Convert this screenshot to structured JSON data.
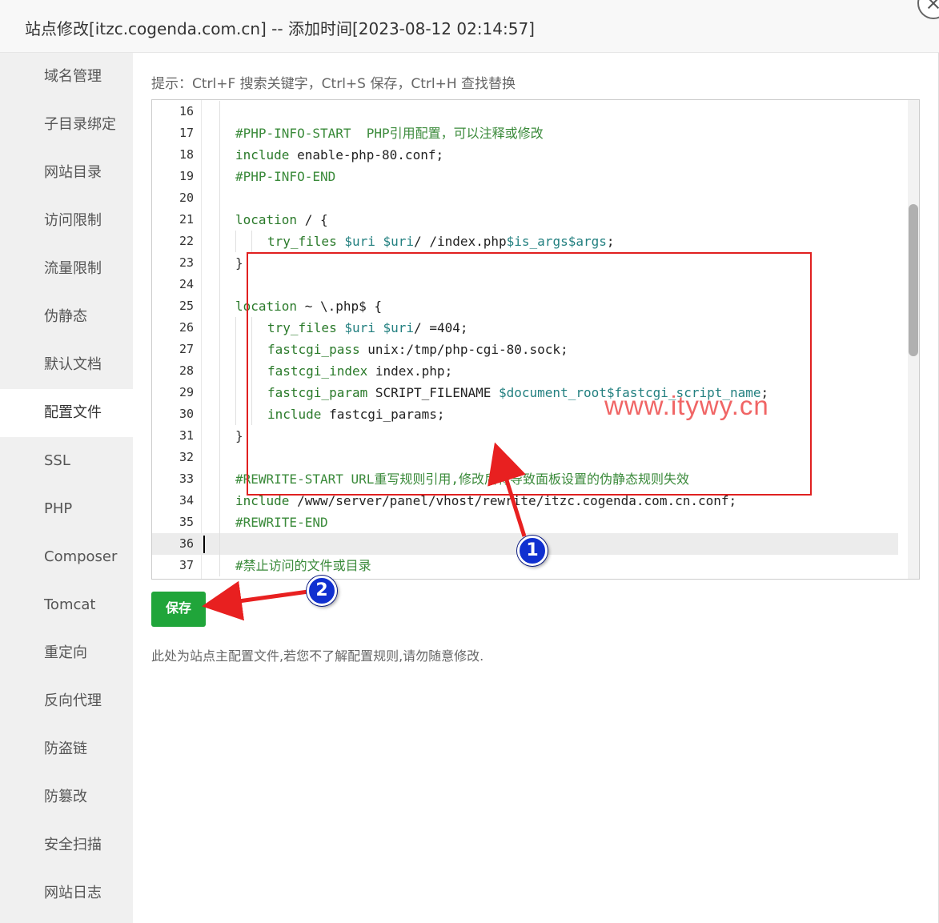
{
  "window": {
    "title": "站点修改[itzc.cogenda.com.cn] -- 添加时间[2023-08-12 02:14:57]"
  },
  "sidebar": {
    "items": [
      {
        "label": "域名管理"
      },
      {
        "label": "子目录绑定"
      },
      {
        "label": "网站目录"
      },
      {
        "label": "访问限制"
      },
      {
        "label": "流量限制"
      },
      {
        "label": "伪静态"
      },
      {
        "label": "默认文档"
      },
      {
        "label": "配置文件",
        "active": true
      },
      {
        "label": "SSL"
      },
      {
        "label": "PHP"
      },
      {
        "label": "Composer"
      },
      {
        "label": "Tomcat"
      },
      {
        "label": "重定向"
      },
      {
        "label": "反向代理"
      },
      {
        "label": "防盗链"
      },
      {
        "label": "防篡改"
      },
      {
        "label": "安全扫描"
      },
      {
        "label": "网站日志"
      }
    ]
  },
  "main": {
    "hint": "提示：Ctrl+F 搜索关键字，Ctrl+S 保存，Ctrl+H 查找替换",
    "save_label": "保存",
    "note": "此处为站点主配置文件,若您不了解配置规则,请勿随意修改."
  },
  "editor": {
    "current_line": "36",
    "lines": [
      {
        "n": "16",
        "parts": []
      },
      {
        "n": "17",
        "parts": [
          [
            "c-comment",
            "#PHP-INFO-START  PHP引用配置，可以注释或修改"
          ]
        ]
      },
      {
        "n": "18",
        "parts": [
          [
            "c-kw",
            "include"
          ],
          [
            "c-plain",
            " enable-php-80.conf;"
          ]
        ]
      },
      {
        "n": "19",
        "parts": [
          [
            "c-comment",
            "#PHP-INFO-END"
          ]
        ]
      },
      {
        "n": "20",
        "parts": []
      },
      {
        "n": "21",
        "parts": [
          [
            "c-kw",
            "location"
          ],
          [
            "c-plain",
            " / {"
          ]
        ]
      },
      {
        "n": "22",
        "deep": true,
        "parts": [
          [
            "c-fn",
            "try_files"
          ],
          [
            "c-plain",
            " "
          ],
          [
            "c-var",
            "$uri"
          ],
          [
            "c-plain",
            " "
          ],
          [
            "c-var",
            "$uri"
          ],
          [
            "c-plain",
            "/ /index.php"
          ],
          [
            "c-var",
            "$is_args$args"
          ],
          [
            "c-plain",
            ";"
          ]
        ]
      },
      {
        "n": "23",
        "parts": [
          [
            "c-brace",
            "}"
          ]
        ]
      },
      {
        "n": "24",
        "parts": []
      },
      {
        "n": "25",
        "parts": [
          [
            "c-kw",
            "location"
          ],
          [
            "c-plain",
            " ~ \\.php$ {"
          ]
        ]
      },
      {
        "n": "26",
        "deep": true,
        "parts": [
          [
            "c-fn",
            "try_files"
          ],
          [
            "c-plain",
            " "
          ],
          [
            "c-var",
            "$uri"
          ],
          [
            "c-plain",
            " "
          ],
          [
            "c-var",
            "$uri"
          ],
          [
            "c-plain",
            "/ =404;"
          ]
        ]
      },
      {
        "n": "27",
        "deep": true,
        "parts": [
          [
            "c-fn",
            "fastcgi_pass"
          ],
          [
            "c-plain",
            " unix:/tmp/php-cgi-80.sock;"
          ]
        ]
      },
      {
        "n": "28",
        "deep": true,
        "parts": [
          [
            "c-fn",
            "fastcgi_index"
          ],
          [
            "c-plain",
            " index.php;"
          ]
        ]
      },
      {
        "n": "29",
        "deep": true,
        "parts": [
          [
            "c-fn",
            "fastcgi_param"
          ],
          [
            "c-plain",
            " SCRIPT_FILENAME "
          ],
          [
            "c-var",
            "$document_root$fastcgi_script_name"
          ],
          [
            "c-plain",
            ";"
          ]
        ]
      },
      {
        "n": "30",
        "deep": true,
        "parts": [
          [
            "c-kw",
            "include"
          ],
          [
            "c-plain",
            " fastcgi_params;"
          ]
        ]
      },
      {
        "n": "31",
        "parts": [
          [
            "c-brace",
            "}"
          ]
        ]
      },
      {
        "n": "32",
        "parts": []
      },
      {
        "n": "33",
        "parts": [
          [
            "c-comment",
            "#REWRITE-START URL重写规则引用,修改后将导致面板设置的伪静态规则失效"
          ]
        ]
      },
      {
        "n": "34",
        "parts": [
          [
            "c-kw",
            "include"
          ],
          [
            "c-plain",
            " /www/server/panel/vhost/rewrite/itzc.cogenda.com.cn.conf;"
          ]
        ]
      },
      {
        "n": "35",
        "parts": [
          [
            "c-comment",
            "#REWRITE-END"
          ]
        ]
      },
      {
        "n": "36",
        "parts": []
      },
      {
        "n": "37",
        "parts": [
          [
            "c-comment",
            "#禁止访问的文件或目录"
          ]
        ]
      }
    ]
  },
  "annotations": {
    "badge1": "1",
    "badge2": "2",
    "watermark": "www.itywy.cn",
    "arrow_color": "#e82020",
    "badge_color": "#1030d0"
  }
}
